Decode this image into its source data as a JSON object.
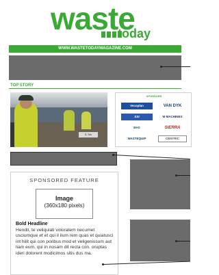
{
  "brand": {
    "word1": "waste",
    "word2": "today",
    "url": "WWW.WASTETODAYMAGAZINE.COM",
    "color": "#3aaa35"
  },
  "sections": {
    "top_story": "TOP STORY",
    "sponsors": "SPONSORS"
  },
  "photo": {
    "sign_text": "E-Tek"
  },
  "sponsors": [
    {
      "name": "Vecoplan",
      "color": "#1d4f9c"
    },
    {
      "name": "VAN DYK",
      "color": "#1d3f7a"
    },
    {
      "name": "SSI",
      "color": "#2a5ab0"
    },
    {
      "name": "M MACHINEX",
      "color": "#1d2f5a"
    },
    {
      "name": "BHS",
      "color": "#1e6b3a"
    },
    {
      "name": "SIERRA",
      "color": "#c8202a"
    },
    {
      "name": "WASTEQUIP",
      "color": "#1d3f7a"
    },
    {
      "name": "CENTRIC",
      "color": "#555555"
    }
  ],
  "sponsored_feature": {
    "title": "SPONSORED FEATURE",
    "image_label": "Image",
    "image_size": "(360x180 pixels)",
    "headline": "Bold Headline",
    "body": "Hendit, te veliquiati voloratem necumet usciumque et et qui il ilum rem quas et quiatusci int hilit qui con poribus mod et veligenissum aut liam eum, qui in nosam dit recta con. oruptas ideri dolorent modicimos sitis dus ma."
  }
}
